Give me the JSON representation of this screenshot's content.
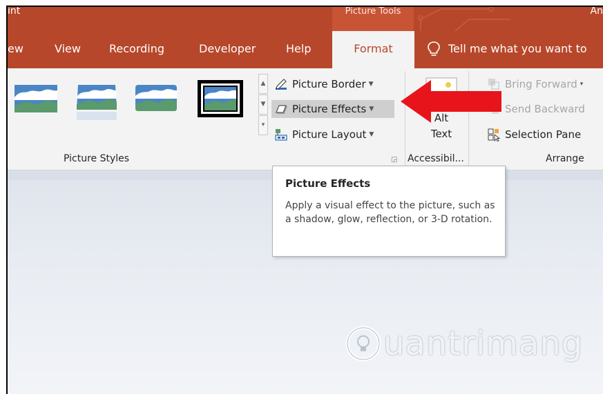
{
  "window": {
    "title_left": "int",
    "title_right": "An",
    "context_label": "Picture Tools"
  },
  "tabs": [
    {
      "label": "ew"
    },
    {
      "label": "View"
    },
    {
      "label": "Recording"
    },
    {
      "label": "Developer"
    },
    {
      "label": "Help"
    },
    {
      "label": "Format"
    }
  ],
  "tell_me": "Tell me what you want to",
  "ribbon": {
    "picture_styles": {
      "group_label": "Picture Styles"
    },
    "adjust_commands": {
      "picture_border": "Picture Border",
      "picture_effects": "Picture Effects",
      "picture_layout": "Picture Layout"
    },
    "accessibility": {
      "alt_text_line1": "Alt",
      "alt_text_line2": "Text",
      "group_label": "Accessibil..."
    },
    "arrange": {
      "bring_forward": "Bring Forward",
      "send_backward": "Send Backward",
      "selection_pane": "Selection Pane",
      "group_label": "Arrange"
    }
  },
  "tooltip": {
    "title": "Picture Effects",
    "body": "Apply a visual effect to the picture, such as a shadow, glow, reflection, or 3-D rotation."
  },
  "watermark": {
    "text": "uantrimang"
  },
  "colors": {
    "accent": "#b7472a",
    "arrow": "#e8141b",
    "ribbon_bg": "#f3f3f3"
  }
}
